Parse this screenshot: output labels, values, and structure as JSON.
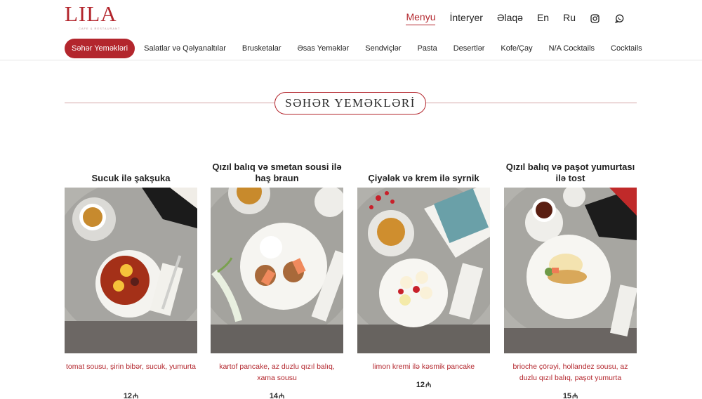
{
  "brand": {
    "name": "LILA",
    "tagline": "CAFE & RESTAURANT",
    "accent_color": "#b3262d"
  },
  "topnav": {
    "items": [
      {
        "label": "Menyu",
        "active": true
      },
      {
        "label": "İnteryer"
      },
      {
        "label": "Əlaqə"
      },
      {
        "label": "En"
      },
      {
        "label": "Ru"
      }
    ],
    "icons": [
      "instagram-icon",
      "whatsapp-icon"
    ]
  },
  "categories": [
    {
      "label": "Səhər Yeməkləri",
      "active": true
    },
    {
      "label": "Salatlar və Qəlyanaltılar"
    },
    {
      "label": "Brusketalar"
    },
    {
      "label": "Əsas Yeməklər"
    },
    {
      "label": "Sendviçlər"
    },
    {
      "label": "Pasta"
    },
    {
      "label": "Desertlər"
    },
    {
      "label": "Kofe/Çay"
    },
    {
      "label": "N/A Cocktails"
    },
    {
      "label": "Cocktails"
    }
  ],
  "section": {
    "title": "SƏHƏR YEMƏKLƏRİ"
  },
  "currency_symbol": "₼",
  "items": [
    {
      "title": "Sucuk ilə şakşuka",
      "description": "tomat sousu, şirin bibər, sucuk, yumurta",
      "price": "12"
    },
    {
      "title": "Qızıl balıq və smetan sousi ilə haş braun",
      "description": "kartof pancake, az duzlu qızıl balıq, xama sousu",
      "price": "14"
    },
    {
      "title": "Çiyələk və krem ilə syrnik",
      "description": "limon kremi ilə kəsmik pancake",
      "price": "12"
    },
    {
      "title": "Qızıl balıq və paşot yumurtası ilə tost",
      "description": "brioche çörəyi, hollandez sousu, az duzlu qızıl balıq, paşot yumurta",
      "price": "15"
    }
  ]
}
